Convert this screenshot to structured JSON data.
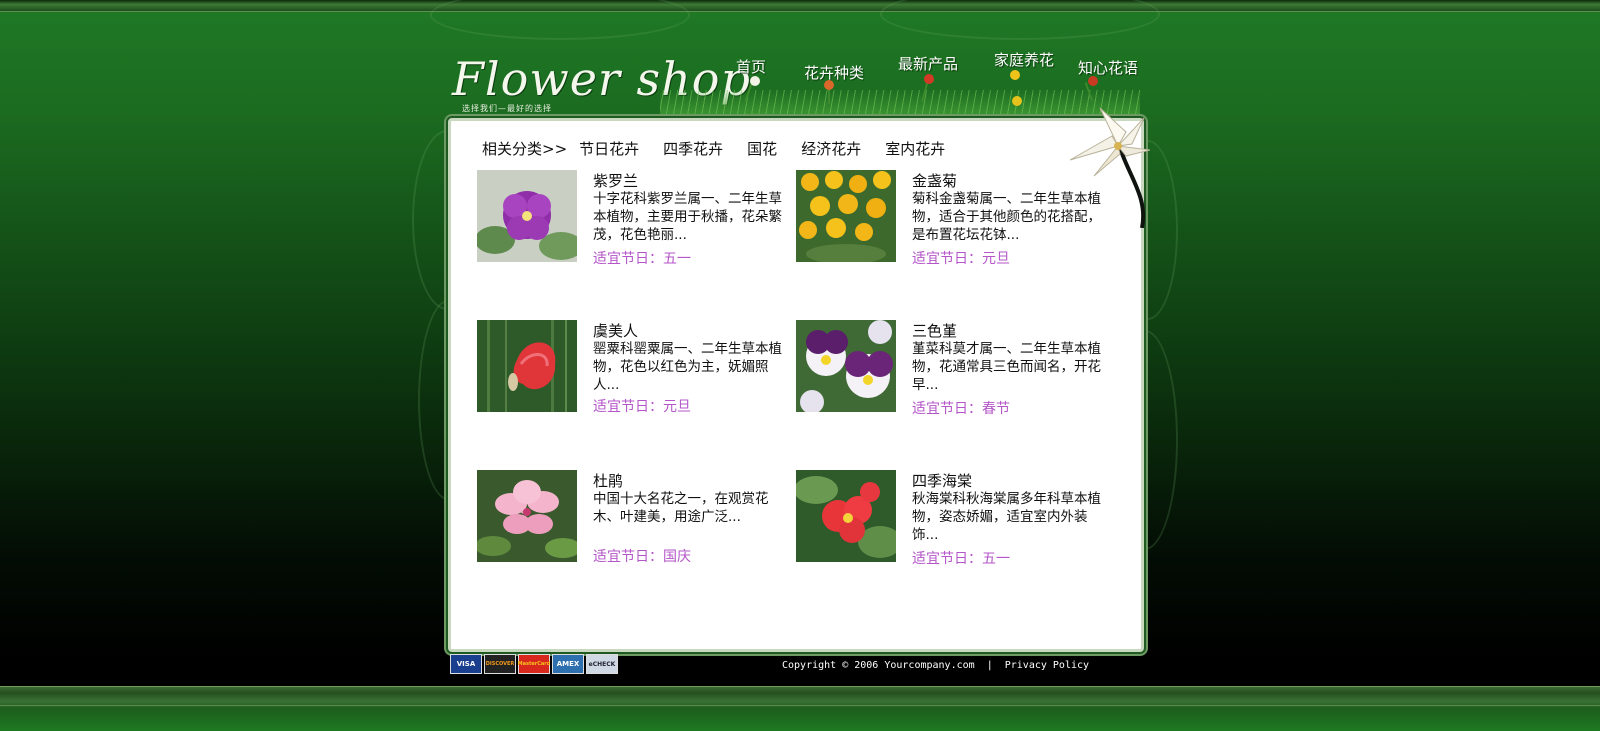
{
  "brand": {
    "logo_text": "Flower shop",
    "tagline": "选择我们—最好的选择"
  },
  "nav": {
    "items": [
      {
        "label": "首页"
      },
      {
        "label": "花卉种类"
      },
      {
        "label": "最新产品"
      },
      {
        "label": "家庭养花"
      },
      {
        "label": "知心花语"
      }
    ]
  },
  "categories": {
    "label": "相关分类>>",
    "items": [
      "节日花卉",
      "四季花卉",
      "国花",
      "经济花卉",
      "室内花卉"
    ]
  },
  "products": [
    {
      "title": "紫罗兰",
      "desc": "十字花科紫罗兰属一、二年生草本植物，主要用于秋播，花朵繁茂，花色艳丽...",
      "holiday": "适宜节日：五一",
      "image": "purple-violet-flower"
    },
    {
      "title": "金盏菊",
      "desc": "菊科金盏菊属一、二年生草本植物，适合于其他颜色的花搭配，是布置花坛花钵...",
      "holiday": "适宜节日：元旦",
      "image": "yellow-marigold-flowers"
    },
    {
      "title": "虞美人",
      "desc": "罂粟科罂粟属一、二年生草本植物，花色以红色为主，妩媚照人...",
      "holiday": "适宜节日：元旦",
      "image": "red-poppy-flower"
    },
    {
      "title": "三色堇",
      "desc": "堇菜科莫才属一、二年生草本植物，花通常具三色而闻名，开花早...",
      "holiday": "适宜节日：春节",
      "image": "pansy-flowers"
    },
    {
      "title": "杜鹃",
      "desc": "中国十大名花之一，在观赏花木、叶建美，用途广泛...",
      "holiday": "适宜节日：国庆",
      "image": "pink-azalea-flower"
    },
    {
      "title": "四季海棠",
      "desc": "秋海棠科秋海棠属多年科草本植物，姿态娇媚，适宜室内外装饰...",
      "holiday": "适宜节日：五一",
      "image": "red-begonia-flower"
    }
  ],
  "footer": {
    "payment_cards": [
      "VISA",
      "DISCOVER",
      "MasterCard",
      "AMEX",
      "eCHECK"
    ],
    "copyright": "Copyright © 2006 Yourcompany.com",
    "separator": "|",
    "privacy": "Privacy Policy"
  },
  "colors": {
    "page_green": "#1b6a20",
    "panel_bg": "#ffffff",
    "holiday_text": "#b455c8"
  }
}
